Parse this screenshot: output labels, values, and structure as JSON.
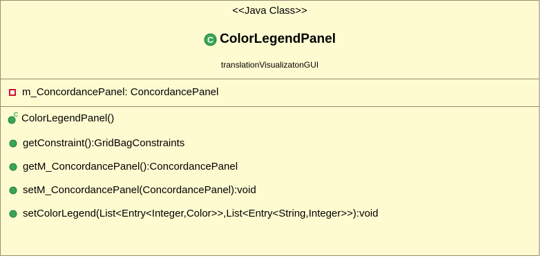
{
  "class_box": {
    "stereotype": "<<Java Class>>",
    "class_name": "ColorLegendPanel",
    "package": "translationVisualizatonGUI"
  },
  "attributes": [
    {
      "text": "m_ConcordancePanel: ConcordancePanel",
      "visibility": "private",
      "icon": "private-field-icon"
    }
  ],
  "operations": [
    {
      "text": "ColorLegendPanel()",
      "visibility": "public",
      "icon": "constructor-icon"
    },
    {
      "text": "getConstraint():GridBagConstraints",
      "visibility": "public",
      "icon": "public-method-icon"
    },
    {
      "text": "getM_ConcordancePanel():ConcordancePanel",
      "visibility": "public",
      "icon": "public-method-icon"
    },
    {
      "text": "setM_ConcordancePanel(ConcordancePanel):void",
      "visibility": "public",
      "icon": "public-method-icon"
    },
    {
      "text": "setColorLegend(List<Entry<Integer,Color>>,List<Entry<String,Integer>>):void",
      "visibility": "public",
      "icon": "public-method-icon"
    }
  ],
  "colors": {
    "background": "#fffbd1",
    "border": "#9b8a6a",
    "class_icon": "#3aa55a",
    "public_method": "#3aa55a",
    "private_field": "#d0102a"
  }
}
